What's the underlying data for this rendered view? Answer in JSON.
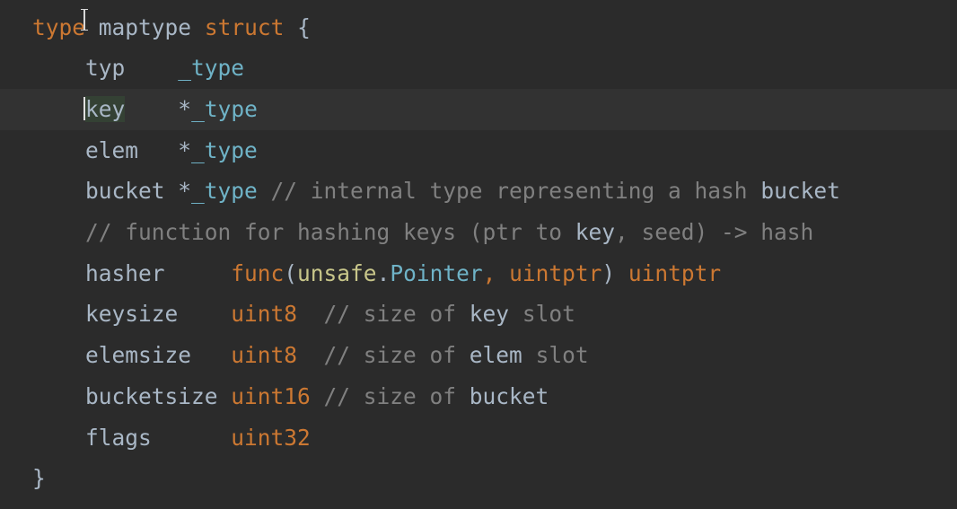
{
  "editor": {
    "language": "Go",
    "lines": [
      {
        "parts": [
          {
            "t": "type",
            "c": "kw"
          },
          {
            "t": " ",
            "c": "ident"
          },
          {
            "t": "maptype",
            "c": "ident"
          },
          {
            "t": " ",
            "c": "ident"
          },
          {
            "t": "struct",
            "c": "kw"
          },
          {
            "t": " {",
            "c": "punc"
          }
        ]
      },
      {
        "parts": [
          {
            "t": "    typ    ",
            "c": "fld"
          },
          {
            "t": "_type",
            "c": "ty"
          }
        ]
      },
      {
        "current": true,
        "parts": [
          {
            "t": "    ",
            "c": "fld"
          },
          {
            "t": "key",
            "c": "fld",
            "hl": true,
            "caret": true
          },
          {
            "t": "    ",
            "c": "fld"
          },
          {
            "t": "*",
            "c": "ident"
          },
          {
            "t": "_type",
            "c": "ty"
          }
        ]
      },
      {
        "parts": [
          {
            "t": "    elem   ",
            "c": "fld"
          },
          {
            "t": "*",
            "c": "ident"
          },
          {
            "t": "_type",
            "c": "ty"
          }
        ]
      },
      {
        "parts": [
          {
            "t": "    bucket ",
            "c": "fld"
          },
          {
            "t": "*",
            "c": "ident"
          },
          {
            "t": "_type",
            "c": "ty"
          },
          {
            "t": " // internal type representing a hash ",
            "c": "cm"
          },
          {
            "t": "bucket",
            "c": "cm-id"
          }
        ]
      },
      {
        "parts": [
          {
            "t": "    // function for hashing keys (ptr to ",
            "c": "cm"
          },
          {
            "t": "key",
            "c": "cm-id"
          },
          {
            "t": ", seed) -> hash",
            "c": "cm"
          }
        ]
      },
      {
        "parts": [
          {
            "t": "    hasher     ",
            "c": "fld"
          },
          {
            "t": "func",
            "c": "kw"
          },
          {
            "t": "(",
            "c": "punc"
          },
          {
            "t": "unsafe",
            "c": "pkg"
          },
          {
            "t": ".",
            "c": "punc"
          },
          {
            "t": "Pointer",
            "c": "ty"
          },
          {
            "t": ", ",
            "c": "punc-o"
          },
          {
            "t": "uintptr",
            "c": "kw"
          },
          {
            "t": ") ",
            "c": "punc"
          },
          {
            "t": "uintptr",
            "c": "kw"
          }
        ]
      },
      {
        "parts": [
          {
            "t": "    keysize    ",
            "c": "fld"
          },
          {
            "t": "uint8",
            "c": "kw"
          },
          {
            "t": "  // size of ",
            "c": "cm"
          },
          {
            "t": "key",
            "c": "cm-id"
          },
          {
            "t": " slot",
            "c": "cm"
          }
        ]
      },
      {
        "parts": [
          {
            "t": "    elemsize   ",
            "c": "fld"
          },
          {
            "t": "uint8",
            "c": "kw"
          },
          {
            "t": "  // size of ",
            "c": "cm"
          },
          {
            "t": "elem",
            "c": "cm-id"
          },
          {
            "t": " slot",
            "c": "cm"
          }
        ]
      },
      {
        "parts": [
          {
            "t": "    bucketsize ",
            "c": "fld"
          },
          {
            "t": "uint16",
            "c": "kw"
          },
          {
            "t": " // size of ",
            "c": "cm"
          },
          {
            "t": "bucket",
            "c": "cm-id"
          }
        ]
      },
      {
        "parts": [
          {
            "t": "    flags      ",
            "c": "fld"
          },
          {
            "t": "uint32",
            "c": "kw"
          }
        ]
      },
      {
        "parts": [
          {
            "t": "}",
            "c": "punc"
          }
        ]
      }
    ]
  },
  "colors": {
    "background": "#2b2b2b",
    "current_line": "#323232",
    "keyword": "#cc7832",
    "type": "#6fb3c7",
    "package": "#c8c68a",
    "comment": "#808080",
    "identifier": "#a9b7c6",
    "identifier_highlight": "#344134"
  }
}
